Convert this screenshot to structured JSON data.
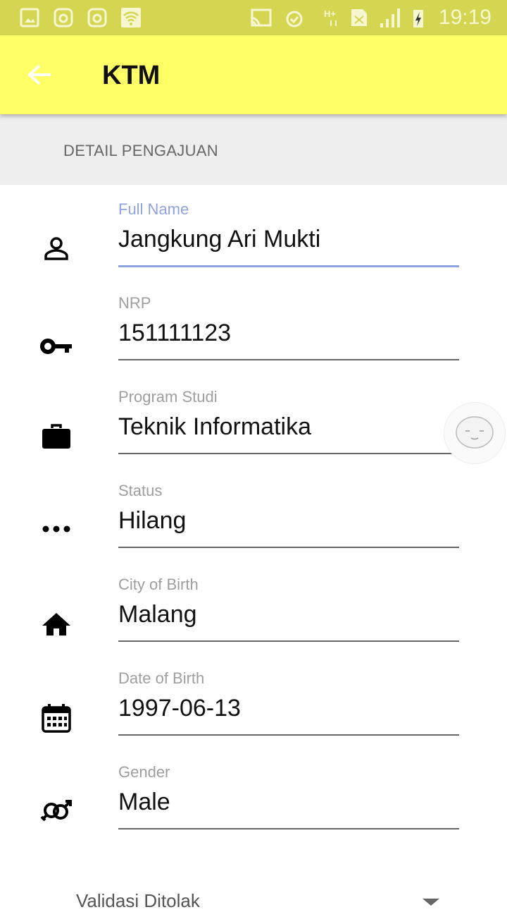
{
  "status_bar": {
    "time": "19:19",
    "icons": [
      "gallery-icon",
      "instagram-icon",
      "instagram-icon",
      "wifi-icon",
      "cast-icon",
      "alarm-icon",
      "h-plus-data-icon",
      "no-sim-icon",
      "signal-icon",
      "battery-charging-icon"
    ]
  },
  "app_bar": {
    "title": "KTM",
    "back_icon": "arrow-back-icon"
  },
  "section": {
    "title": "DETAIL PENGAJUAN"
  },
  "accent": "#8fa3e0",
  "fields": [
    {
      "label": "Full Name",
      "value": "Jangkung Ari Mukti",
      "icon": "person-icon"
    },
    {
      "label": "NRP",
      "value": "151111123",
      "icon": "key-icon"
    },
    {
      "label": "Program Studi",
      "value": "Teknik Informatika",
      "icon": "briefcase-icon"
    },
    {
      "label": "Status",
      "value": "Hilang",
      "icon": "more-horiz-icon"
    },
    {
      "label": "City of Birth",
      "value": "Malang",
      "icon": "home-icon"
    },
    {
      "label": "Date of Birth",
      "value": "1997-06-13",
      "icon": "calendar-icon"
    },
    {
      "label": "Gender",
      "value": "Male",
      "icon": "gender-icon"
    }
  ],
  "dropdown": {
    "selected": "Validasi Ditolak"
  }
}
